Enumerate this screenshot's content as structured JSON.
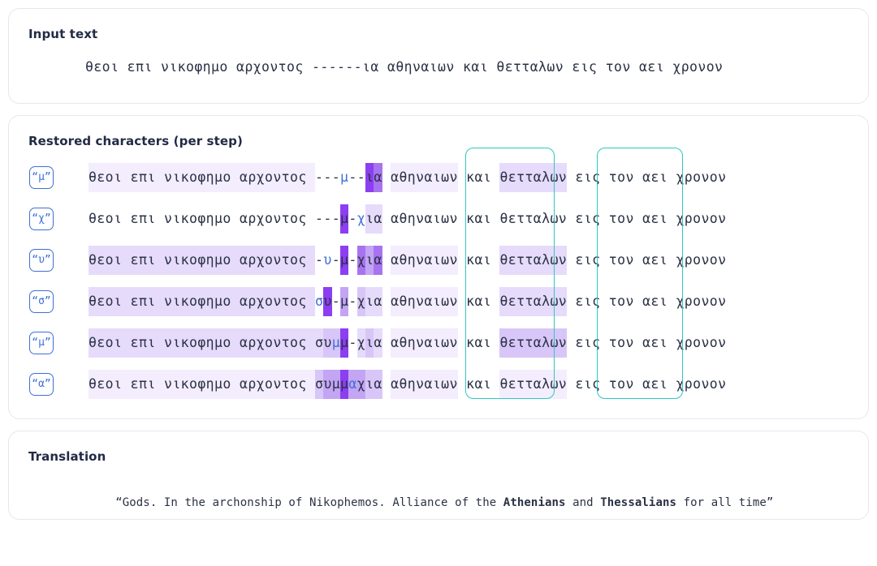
{
  "input_card": {
    "title": "Input text",
    "text": "θεοι επι νικοφημο αρχοντος ------ια αθηναιων και θετταλων εις τον αει χρονον"
  },
  "steps_card": {
    "title": "Restored characters (per step)",
    "prefix": "θεοι επι νικοφημο αρχοντος ",
    "mid_gap": " ",
    "between": " και ",
    "suffix": " εις τον αει χρονον",
    "word_athenians": "αθηναιων",
    "word_thessalians": "θετταλων",
    "teal_boxes": [
      {
        "name": "athenians",
        "label": "αθηναιων"
      },
      {
        "name": "thessalians",
        "label": "θετταλων"
      }
    ],
    "accent_teal": "#2fc7c0",
    "accent_blue": "#3f6fd8",
    "accent_purple": "#8b3ff0",
    "rows": [
      {
        "chip": "“μ”",
        "restored_char": "μ",
        "gap_text": "---μ--ια",
        "gap": [
          {
            "c": "-",
            "h": 0,
            "new": false
          },
          {
            "c": "-",
            "h": 0,
            "new": false
          },
          {
            "c": "-",
            "h": 0,
            "new": false
          },
          {
            "c": "μ",
            "h": 0,
            "new": true
          },
          {
            "c": "-",
            "h": 0,
            "new": false
          },
          {
            "c": "-",
            "h": 0,
            "new": false
          },
          {
            "c": "ι",
            "h": 6,
            "new": false
          },
          {
            "c": "α",
            "h": 5,
            "new": false
          }
        ],
        "prefix_hl": 1,
        "athenians_hl": 1,
        "thessalians_hl": 2
      },
      {
        "chip": "“χ”",
        "restored_char": "χ",
        "gap_text": "---μ-χια",
        "gap": [
          {
            "c": "-",
            "h": 0,
            "new": false
          },
          {
            "c": "-",
            "h": 0,
            "new": false
          },
          {
            "c": "-",
            "h": 0,
            "new": false
          },
          {
            "c": "μ",
            "h": 6,
            "new": false
          },
          {
            "c": "-",
            "h": 0,
            "new": false
          },
          {
            "c": "χ",
            "h": 0,
            "new": true
          },
          {
            "c": "ι",
            "h": 2,
            "new": false
          },
          {
            "c": "α",
            "h": 2,
            "new": false
          }
        ],
        "prefix_hl": 0,
        "athenians_hl": 0,
        "thessalians_hl": 0
      },
      {
        "chip": "“υ”",
        "restored_char": "υ",
        "gap_text": "-υ-μ-χια",
        "gap": [
          {
            "c": "-",
            "h": 0,
            "new": false
          },
          {
            "c": "υ",
            "h": 0,
            "new": true
          },
          {
            "c": "-",
            "h": 0,
            "new": false
          },
          {
            "c": "μ",
            "h": 6,
            "new": false
          },
          {
            "c": "-",
            "h": 0,
            "new": false
          },
          {
            "c": "χ",
            "h": 5,
            "new": false
          },
          {
            "c": "ι",
            "h": 4,
            "new": false
          },
          {
            "c": "α",
            "h": 5,
            "new": false
          }
        ],
        "prefix_hl": 2,
        "athenians_hl": 1,
        "thessalians_hl": 2
      },
      {
        "chip": "“σ”",
        "restored_char": "σ",
        "gap_text": "συ-μ-χια",
        "gap": [
          {
            "c": "σ",
            "h": 0,
            "new": true
          },
          {
            "c": "υ",
            "h": 6,
            "new": false
          },
          {
            "c": "-",
            "h": 0,
            "new": false
          },
          {
            "c": "μ",
            "h": 4,
            "new": false
          },
          {
            "c": "-",
            "h": 0,
            "new": false
          },
          {
            "c": "χ",
            "h": 3,
            "new": false
          },
          {
            "c": "ι",
            "h": 2,
            "new": false
          },
          {
            "c": "α",
            "h": 2,
            "new": false
          }
        ],
        "prefix_hl": 2,
        "athenians_hl": 1,
        "thessalians_hl": 2
      },
      {
        "chip": "“μ”",
        "restored_char": "μ",
        "gap_text": "συμμ-χια",
        "gap": [
          {
            "c": "σ",
            "h": 2,
            "new": false
          },
          {
            "c": "υ",
            "h": 3,
            "new": false
          },
          {
            "c": "μ",
            "h": 3,
            "new": true
          },
          {
            "c": "μ",
            "h": 6,
            "new": false
          },
          {
            "c": "-",
            "h": 0,
            "new": false
          },
          {
            "c": "χ",
            "h": 2,
            "new": false
          },
          {
            "c": "ι",
            "h": 3,
            "new": false
          },
          {
            "c": "α",
            "h": 2,
            "new": false
          }
        ],
        "prefix_hl": 2,
        "athenians_hl": 1,
        "thessalians_hl": 3
      },
      {
        "chip": "“α”",
        "restored_char": "α",
        "gap_text": "συμμαχια",
        "gap": [
          {
            "c": "σ",
            "h": 3,
            "new": false
          },
          {
            "c": "υ",
            "h": 4,
            "new": false
          },
          {
            "c": "μ",
            "h": 4,
            "new": false
          },
          {
            "c": "μ",
            "h": 6,
            "new": false
          },
          {
            "c": "α",
            "h": 4,
            "new": true
          },
          {
            "c": "χ",
            "h": 4,
            "new": false
          },
          {
            "c": "ι",
            "h": 3,
            "new": false
          },
          {
            "c": "α",
            "h": 3,
            "new": false
          }
        ],
        "prefix_hl": 1,
        "athenians_hl": 1,
        "thessalians_hl": 1
      }
    ]
  },
  "translation_card": {
    "title": "Translation",
    "text_before_1": "“Gods. In the archonship of Nikophemos. Alliance of the ",
    "bold_1": "Athenians",
    "text_between": " and ",
    "bold_2": "Thessalians",
    "text_after": " for all time”"
  }
}
